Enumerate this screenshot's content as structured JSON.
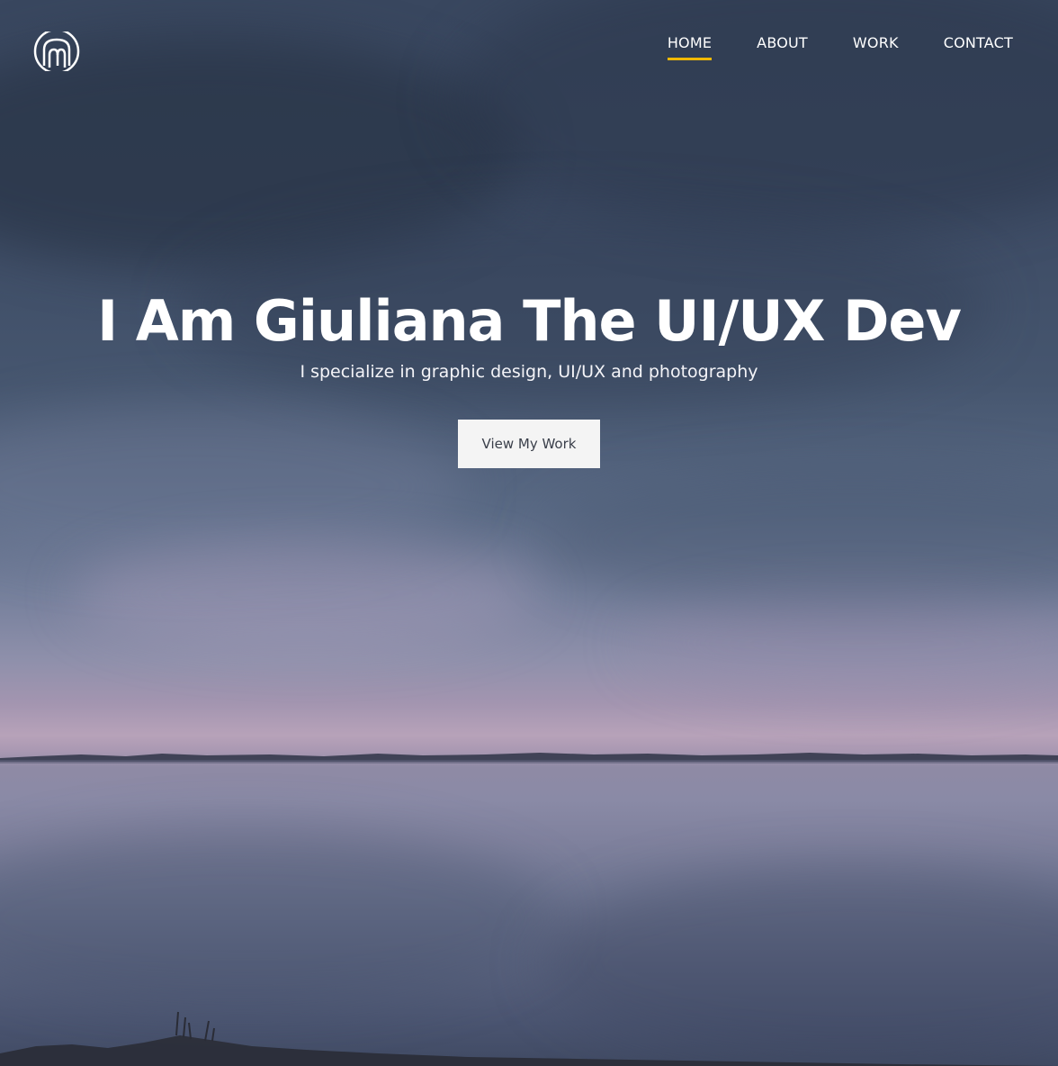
{
  "header": {
    "logo_icon": "monogram-logo-icon",
    "nav": [
      {
        "label": "HOME",
        "active": true
      },
      {
        "label": "ABOUT",
        "active": false
      },
      {
        "label": "WORK",
        "active": false
      },
      {
        "label": "CONTACT",
        "active": false
      }
    ],
    "accent_color": "#f0b800"
  },
  "hero": {
    "title": "I Am Giuliana The UI/UX Dev",
    "subtitle": "I specialize in graphic design, UI/UX and photography",
    "cta_label": "View My Work",
    "background": "lake-at-dusk-photo"
  }
}
